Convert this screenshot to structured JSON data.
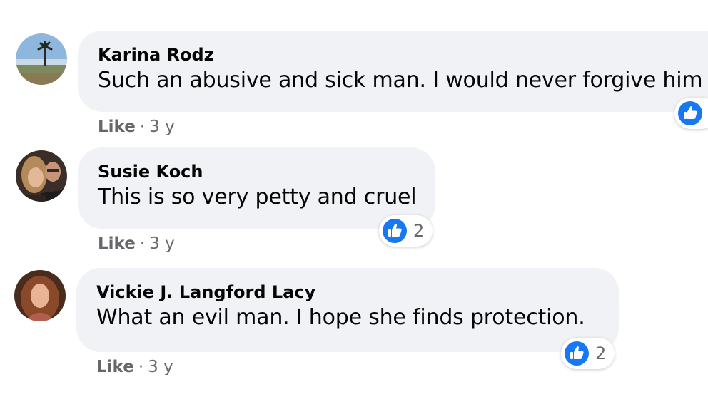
{
  "comments": [
    {
      "author": "Karina Rodz",
      "text": "Such an abusive and sick man. I would never forgive him",
      "like_label": "Like",
      "separator": "·",
      "age": "3 y",
      "reaction_count": ""
    },
    {
      "author": "Susie Koch",
      "text": "This is so very petty and cruel",
      "like_label": "Like",
      "separator": "·",
      "age": "3 y",
      "reaction_count": "2"
    },
    {
      "author": "Vickie J. Langford Lacy",
      "text": "What an evil man. I hope she finds protection.",
      "like_label": "Like",
      "separator": "·",
      "age": "3 y",
      "reaction_count": "2"
    }
  ],
  "icons": {
    "reaction": "like-thumbs-up-icon"
  },
  "colors": {
    "bubble_bg": "#f0f2f5",
    "like_blue": "#1877f2",
    "meta_gray": "#65676b",
    "text": "#050505"
  }
}
